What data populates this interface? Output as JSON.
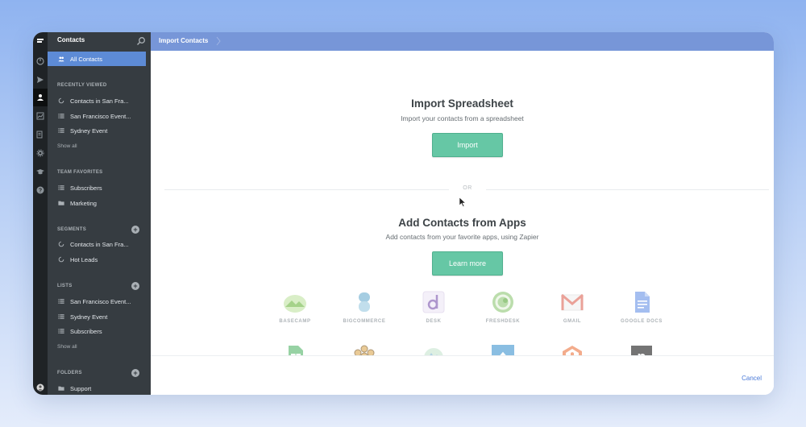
{
  "sidebar": {
    "title": "Contacts",
    "active_item": "All Contacts",
    "recently_viewed": {
      "heading": "RECENTLY VIEWED",
      "items": [
        "Contacts in San Fra...",
        "San Francisco Event...",
        "Sydney Event"
      ],
      "show_all": "Show all"
    },
    "team_favorites": {
      "heading": "TEAM FAVORITES",
      "items": [
        "Subscribers",
        "Marketing"
      ]
    },
    "segments": {
      "heading": "SEGMENTS",
      "items": [
        "Contacts in San Fra...",
        "Hot Leads"
      ]
    },
    "lists": {
      "heading": "LISTS",
      "items": [
        "San Francisco Event...",
        "Sydney Event",
        "Subscribers"
      ],
      "show_all": "Show all"
    },
    "folders": {
      "heading": "FOLDERS",
      "items": [
        "Support"
      ]
    }
  },
  "topbar": {
    "breadcrumb": "Import Contacts"
  },
  "import": {
    "title": "Import Spreadsheet",
    "subtitle": "Import your contacts from a spreadsheet",
    "button": "Import"
  },
  "divider": "OR",
  "apps_section": {
    "title": "Add Contacts from Apps",
    "subtitle": "Add contacts from your favorite apps, using Zapier",
    "button": "Learn more",
    "apps": [
      "BASECAMP",
      "BIGCOMMERCE",
      "DESK",
      "FRESHDESK",
      "GMAIL",
      "GOOGLE DOCS"
    ]
  },
  "footer": {
    "cancel": "Cancel"
  },
  "colors": {
    "accent_button": "#66c7a5",
    "topbar": "#7796d8",
    "sidebar": "#363c41",
    "active_item": "#5d8bd6"
  }
}
